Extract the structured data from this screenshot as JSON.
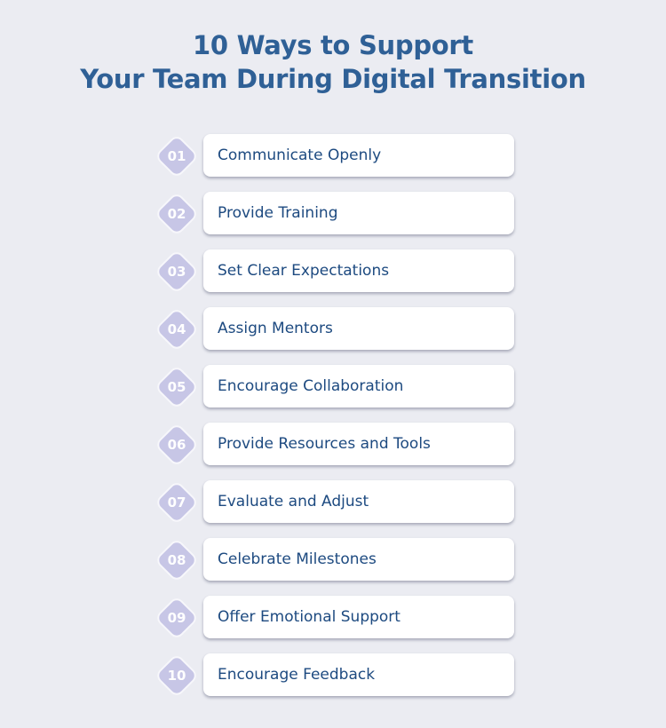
{
  "title": {
    "line1": "10 Ways to Support",
    "line2": "Your Team During Digital Transition"
  },
  "colors": {
    "background": "#ebecf2",
    "title": "#2f6096",
    "badge": "#c7c6e6",
    "card_text": "#1d4a80"
  },
  "items": [
    {
      "number": "01",
      "label": "Communicate Openly"
    },
    {
      "number": "02",
      "label": "Provide Training"
    },
    {
      "number": "03",
      "label": "Set Clear Expectations"
    },
    {
      "number": "04",
      "label": "Assign Mentors"
    },
    {
      "number": "05",
      "label": "Encourage Collaboration"
    },
    {
      "number": "06",
      "label": "Provide Resources and Tools"
    },
    {
      "number": "07",
      "label": "Evaluate and Adjust"
    },
    {
      "number": "08",
      "label": "Celebrate Milestones"
    },
    {
      "number": "09",
      "label": "Offer Emotional Support"
    },
    {
      "number": "10",
      "label": "Encourage Feedback"
    }
  ]
}
